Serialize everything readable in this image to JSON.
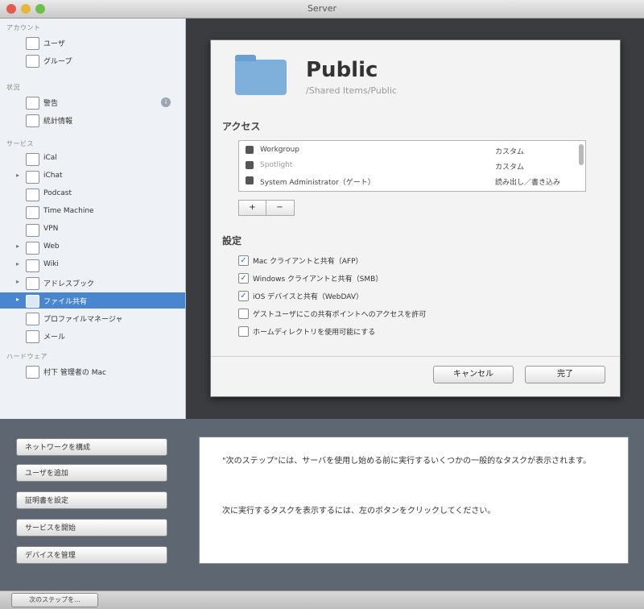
{
  "window": {
    "title": "Server"
  },
  "sidebar": {
    "sections": [
      {
        "label": "アカウント",
        "items": [
          {
            "label": "ユーザ",
            "icon": "user-icon"
          },
          {
            "label": "グループ",
            "icon": "group-icon"
          }
        ]
      },
      {
        "label": "状況",
        "items": [
          {
            "label": "警告",
            "icon": "alert-icon"
          },
          {
            "label": "統計情報",
            "icon": "stats-icon"
          }
        ]
      },
      {
        "label": "サービス",
        "items": [
          {
            "label": "iCal",
            "icon": "calendar-icon"
          },
          {
            "label": "iChat",
            "icon": "chat-icon"
          },
          {
            "label": "Podcast",
            "icon": "podcast-icon"
          },
          {
            "label": "Time Machine",
            "icon": "time-machine-icon"
          },
          {
            "label": "VPN",
            "icon": "vpn-icon"
          },
          {
            "label": "Web",
            "icon": "web-icon"
          },
          {
            "label": "Wiki",
            "icon": "wiki-icon"
          },
          {
            "label": "アドレスブック",
            "icon": "address-book-icon"
          },
          {
            "label": "ファイル共有",
            "icon": "file-sharing-icon"
          },
          {
            "label": "プロファイルマネージャ",
            "icon": "profile-manager-icon"
          },
          {
            "label": "メール",
            "icon": "mail-icon"
          }
        ]
      },
      {
        "label": "ハードウェア",
        "items": [
          {
            "label": "村下 管理者の Mac",
            "icon": "mac-icon"
          }
        ]
      }
    ],
    "info_glyph": "i"
  },
  "sheet": {
    "title": "Public",
    "subtitle": "/Shared Items/Public",
    "access_heading": "アクセス",
    "access_rows": [
      {
        "name": "Workgroup",
        "permission": "カスタム"
      },
      {
        "name": "Spotlight",
        "permission": "カスタム"
      },
      {
        "name": "System Administrator（ゲート）",
        "permission": "読み出し／書き込み"
      }
    ],
    "plus_label": "+",
    "minus_label": "−",
    "settings_heading": "設定",
    "options": [
      {
        "label": "Mac クライアントと共有（AFP）",
        "checked": true
      },
      {
        "label": "Windows クライアントと共有（SMB）",
        "checked": true
      },
      {
        "label": "iOS デバイスと共有（WebDAV）",
        "checked": true
      },
      {
        "label": "ゲストユーザにこの共有ポイントへのアクセスを許可",
        "checked": false
      },
      {
        "label": "ホームディレクトリを使用可能にする",
        "checked": false
      }
    ],
    "cancel_label": "キャンセル",
    "done_label": "完了"
  },
  "bottom": {
    "buttons": [
      "ネットワークを構成",
      "ユーザを追加",
      "証明書を設定",
      "サービスを開始",
      "デバイスを管理"
    ],
    "message_line1": "\"次のステップ\"には、サーバを使用し始める前に実行するいくつかの一般的なタスクが表示されます。",
    "message_line2": "次に実行するタスクを表示するには、左のボタンをクリックしてください。"
  },
  "statusbar": {
    "button_label": "次のステップを..."
  },
  "colors": {
    "selection": "#4a86cf",
    "dark_pane": "#3a3c40",
    "bottom_pane": "#5e6671"
  }
}
